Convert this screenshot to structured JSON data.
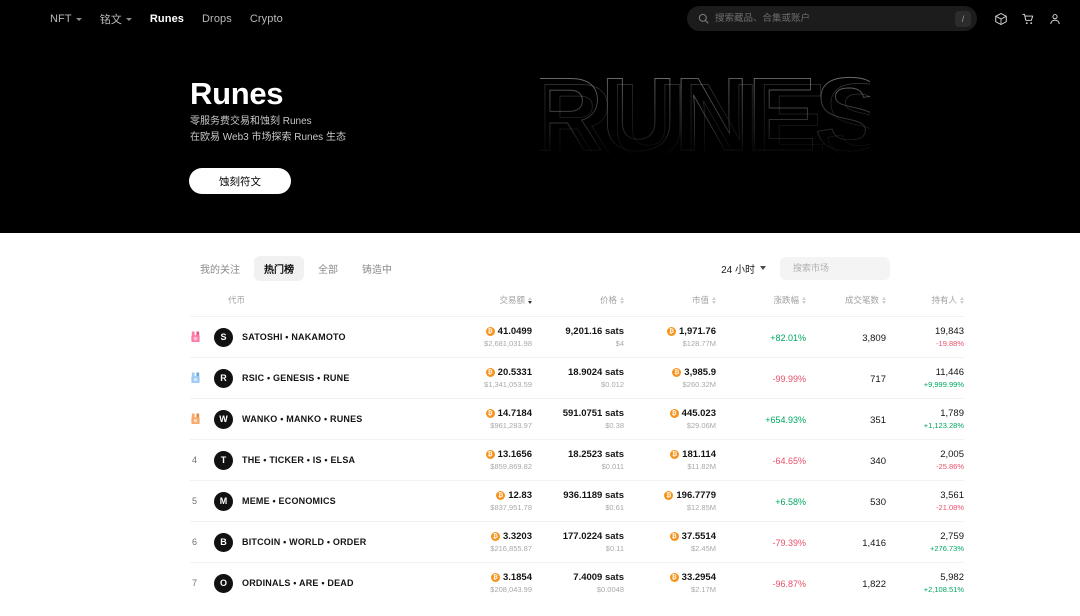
{
  "nav": {
    "items": [
      {
        "label": "NFT",
        "has_caret": true,
        "active": false
      },
      {
        "label": "铭文",
        "has_caret": true,
        "active": false
      },
      {
        "label": "Runes",
        "has_caret": false,
        "active": true
      },
      {
        "label": "Drops",
        "has_caret": false,
        "active": false
      },
      {
        "label": "Crypto",
        "has_caret": false,
        "active": false
      }
    ],
    "search_placeholder": "搜索藏品、合集或账户",
    "search_value": "",
    "slash_hint": "/",
    "icons": [
      "cube-icon",
      "cart-icon",
      "user-icon"
    ]
  },
  "hero": {
    "title": "Runes",
    "subtitle_line1": "零服务费交易和蚀刻 Runes",
    "subtitle_line2": "在欧易 Web3 市场探索 Runes 生态",
    "cta_label": "蚀刻符文",
    "art_text": "RUNES"
  },
  "toolbar": {
    "tabs": [
      {
        "label": "我的关注",
        "active": false
      },
      {
        "label": "热门榜",
        "active": true
      },
      {
        "label": "全部",
        "active": false
      },
      {
        "label": "铸造中",
        "active": false
      }
    ],
    "period_label": "24 小时",
    "market_search_placeholder": "搜索市场",
    "market_search_value": ""
  },
  "table": {
    "headers": [
      {
        "label": "代币",
        "sortable": false,
        "sorted": false
      },
      {
        "label": "交易额",
        "sortable": true,
        "sorted": true
      },
      {
        "label": "价格",
        "sortable": true,
        "sorted": false
      },
      {
        "label": "市值",
        "sortable": true,
        "sorted": false
      },
      {
        "label": "涨跌幅",
        "sortable": true,
        "sorted": false
      },
      {
        "label": "成交笔数",
        "sortable": true,
        "sorted": false
      },
      {
        "label": "持有人",
        "sortable": true,
        "sorted": false
      }
    ],
    "rows": [
      {
        "rank": "1",
        "medal": "gold-medal-icon",
        "initial": "S",
        "name": "SATOSHI • NAKAMOTO",
        "volume_btc": "41.0499",
        "volume_usd": "$2,681,031.98",
        "price": "9,201.16 sats",
        "price_usd": "$4",
        "mcap_btc": "1,971.76",
        "mcap_usd": "$128.77M",
        "change": "+82.01%",
        "change_dir": "pos",
        "trades": "3,809",
        "holders": "19,843",
        "holders_change": "-19.88%",
        "holders_dir": "neg"
      },
      {
        "rank": "2",
        "medal": "silver-medal-icon",
        "initial": "R",
        "name": "RSIC • GENESIS • RUNE",
        "volume_btc": "20.5331",
        "volume_usd": "$1,341,053.59",
        "price": "18.9024 sats",
        "price_usd": "$0.012",
        "mcap_btc": "3,985.9",
        "mcap_usd": "$260.32M",
        "change": "-99.99%",
        "change_dir": "neg",
        "trades": "717",
        "holders": "11,446",
        "holders_change": "+9,999.99%",
        "holders_dir": "pos"
      },
      {
        "rank": "3",
        "medal": "bronze-medal-icon",
        "initial": "W",
        "name": "WANKO • MANKO • RUNES",
        "volume_btc": "14.7184",
        "volume_usd": "$961,283.97",
        "price": "591.0751 sats",
        "price_usd": "$0.38",
        "mcap_btc": "445.023",
        "mcap_usd": "$29.06M",
        "change": "+654.93%",
        "change_dir": "pos",
        "trades": "351",
        "holders": "1,789",
        "holders_change": "+1,123.28%",
        "holders_dir": "pos"
      },
      {
        "rank": "4",
        "medal": "",
        "initial": "T",
        "name": "THE • TICKER • IS • ELSA",
        "volume_btc": "13.1656",
        "volume_usd": "$859,869.82",
        "price": "18.2523 sats",
        "price_usd": "$0.011",
        "mcap_btc": "181.114",
        "mcap_usd": "$11.82M",
        "change": "-64.65%",
        "change_dir": "neg",
        "trades": "340",
        "holders": "2,005",
        "holders_change": "-25.86%",
        "holders_dir": "neg"
      },
      {
        "rank": "5",
        "medal": "",
        "initial": "M",
        "name": "MEME • ECONOMICS",
        "volume_btc": "12.83",
        "volume_usd": "$837,951.78",
        "price": "936.1189 sats",
        "price_usd": "$0.61",
        "mcap_btc": "196.7779",
        "mcap_usd": "$12.85M",
        "change": "+6.58%",
        "change_dir": "pos",
        "trades": "530",
        "holders": "3,561",
        "holders_change": "-21.08%",
        "holders_dir": "neg"
      },
      {
        "rank": "6",
        "medal": "",
        "initial": "B",
        "name": "BITCOIN • WORLD • ORDER",
        "volume_btc": "3.3203",
        "volume_usd": "$216,855.87",
        "price": "177.0224 sats",
        "price_usd": "$0.11",
        "mcap_btc": "37.5514",
        "mcap_usd": "$2.45M",
        "change": "-79.39%",
        "change_dir": "neg",
        "trades": "1,416",
        "holders": "2,759",
        "holders_change": "+276.73%",
        "holders_dir": "pos"
      },
      {
        "rank": "7",
        "medal": "",
        "initial": "O",
        "name": "ORDINALS • ARE • DEAD",
        "volume_btc": "3.1854",
        "volume_usd": "$208,043.99",
        "price": "7.4009 sats",
        "price_usd": "$0.0048",
        "mcap_btc": "33.2954",
        "mcap_usd": "$2.17M",
        "change": "-96.87%",
        "change_dir": "neg",
        "trades": "1,822",
        "holders": "5,982",
        "holders_change": "+2,108.51%",
        "holders_dir": "pos"
      }
    ]
  },
  "colors": {
    "positive": "#00a660",
    "negative": "#e8506a",
    "btc": "#f7931a",
    "hero_bg": "#000000"
  }
}
